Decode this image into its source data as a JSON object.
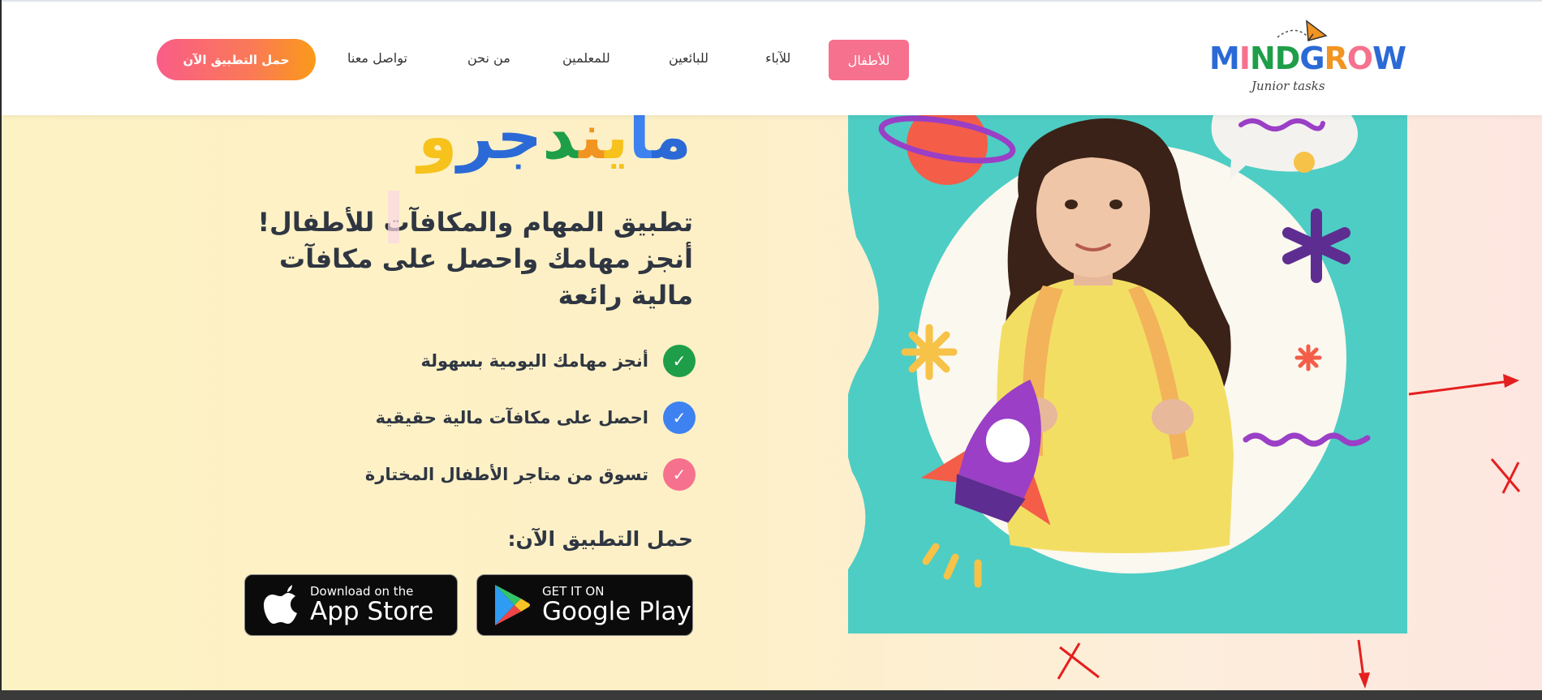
{
  "header": {
    "cta_label": "حمل التطبيق الآن",
    "nav": [
      {
        "label": "تواصل معنا"
      },
      {
        "label": "من نحن"
      },
      {
        "label": "للمعلمين"
      },
      {
        "label": "للبائعين"
      },
      {
        "label": "للآباء"
      },
      {
        "label": "للأطفال",
        "active": true
      }
    ],
    "logo": {
      "text": "MINDGROW",
      "tagline": "Junior tasks"
    }
  },
  "hero": {
    "brand_title": "مايندجرو",
    "heading_lines": [
      "تطبيق المهام والمكافآت للأطفال!",
      "أنجز مهامك واحصل على مكافآت",
      "مالية رائعة"
    ],
    "features": [
      {
        "text": "أنجز مهامك اليومية بسهولة",
        "icon": "check-icon",
        "color": "#1e9e48"
      },
      {
        "text": "احصل على مكافآت مالية حقيقية",
        "icon": "check-icon",
        "color": "#3d82f0"
      },
      {
        "text": "تسوق من متاجر الأطفال المختارة",
        "icon": "check-icon",
        "color": "#f6718e"
      }
    ],
    "download_label": "حمل التطبيق الآن:",
    "app_store": {
      "small": "Download on the",
      "big": "App Store"
    },
    "google_play": {
      "small": "GET IT ON",
      "big": "Google Play"
    }
  },
  "colors": {
    "accent_pink": "#f6718e",
    "teal": "#4ecdc4",
    "title_colors": [
      "#f6c21b",
      "#2b6ad6",
      "#1e9e48",
      "#f29421",
      "#f6c21b",
      "#2b6ad6",
      "#3d82f0"
    ]
  }
}
